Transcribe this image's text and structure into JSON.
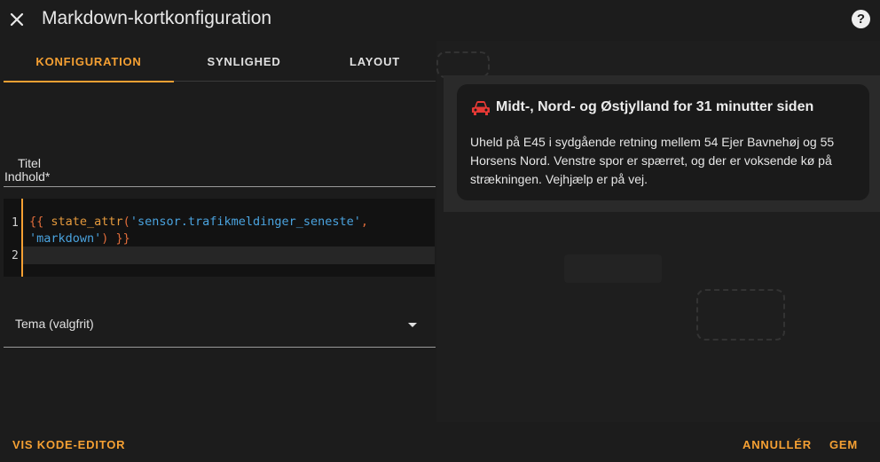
{
  "header": {
    "title": "Markdown-kortkonfiguration",
    "close_icon": "close-icon",
    "help_icon": "help-icon",
    "help_glyph": "?"
  },
  "tabs": [
    {
      "label": "KONFIGURATION",
      "active": true
    },
    {
      "label": "SYNLIGHED",
      "active": false
    },
    {
      "label": "LAYOUT",
      "active": false
    }
  ],
  "form": {
    "title_label": "Titel",
    "content_label": "Indhold*",
    "code_line_numbers": [
      "1",
      "2"
    ],
    "code": {
      "open": "{{ ",
      "fn": "state_attr",
      "paren_open": "(",
      "arg1": "'sensor.trafikmeldinger_seneste'",
      "comma": ",",
      "arg2": "'markdown'",
      "close": ") }}"
    },
    "theme_label": "Tema (valgfrit)"
  },
  "preview": {
    "icon": "car-icon",
    "title": "Midt-, Nord- og Østjylland for 31 minutter siden",
    "body": "Uheld på E45 i sydgående retning mellem 54 Ejer Bavnehøj og 55 Horsens Nord. Venstre spor er spærret, og der er voksende kø på strækningen. Vejhjælp er på vej."
  },
  "footer": {
    "code_editor": "VIS KODE-EDITOR",
    "cancel": "ANNULLÉR",
    "save": "GEM"
  },
  "colors": {
    "accent": "#f5a033",
    "card_icon": "#e53935"
  }
}
